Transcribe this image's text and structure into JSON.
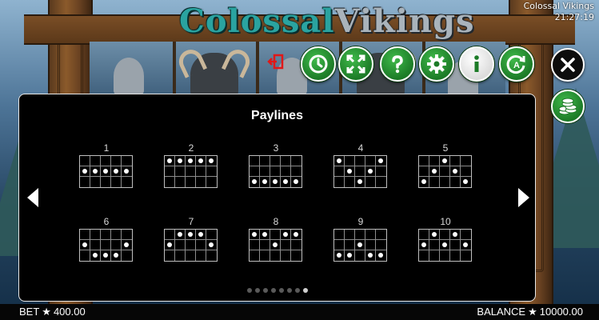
{
  "window": {
    "title": "Colossal Vikings",
    "clock": "21:27:19"
  },
  "logo": {
    "part1": "Colossal",
    "part2": "Vikings"
  },
  "toolbar": {
    "exit_icon": "exit-icon",
    "buttons": [
      {
        "name": "autoplay-clock-button",
        "icon": "clock-icon"
      },
      {
        "name": "fullscreen-button",
        "icon": "expand-arrows-icon"
      },
      {
        "name": "help-button",
        "icon": "question-icon"
      },
      {
        "name": "settings-button",
        "icon": "gear-icon"
      },
      {
        "name": "info-button",
        "icon": "info-icon"
      },
      {
        "name": "autoplay-button",
        "icon": "autoplay-icon"
      }
    ],
    "close_icon": "close-icon",
    "coins_icon": "coins-stack-icon"
  },
  "panel": {
    "title": "Paylines",
    "paylines": [
      {
        "label": "1",
        "rows": [
          1,
          1,
          1,
          1,
          1
        ]
      },
      {
        "label": "2",
        "rows": [
          0,
          0,
          0,
          0,
          0
        ]
      },
      {
        "label": "3",
        "rows": [
          2,
          2,
          2,
          2,
          2
        ]
      },
      {
        "label": "4",
        "rows": [
          0,
          1,
          2,
          1,
          0
        ]
      },
      {
        "label": "5",
        "rows": [
          2,
          1,
          0,
          1,
          2
        ]
      },
      {
        "label": "6",
        "rows": [
          1,
          2,
          2,
          2,
          1
        ]
      },
      {
        "label": "7",
        "rows": [
          1,
          0,
          0,
          0,
          1
        ]
      },
      {
        "label": "8",
        "rows": [
          0,
          0,
          1,
          0,
          0
        ]
      },
      {
        "label": "9",
        "rows": [
          2,
          2,
          1,
          2,
          2
        ]
      },
      {
        "label": "10",
        "rows": [
          1,
          0,
          1,
          0,
          1
        ]
      }
    ],
    "page_count": 8,
    "active_page": 8
  },
  "footer": {
    "bet_label": "BET",
    "bet_value": "400.00",
    "balance_label": "BALANCE",
    "balance_value": "10000.00",
    "star": "★"
  },
  "colors": {
    "accent_green": "#1c7b27",
    "panel_bg": "#000000",
    "logo_teal": "#2aa3a0"
  }
}
